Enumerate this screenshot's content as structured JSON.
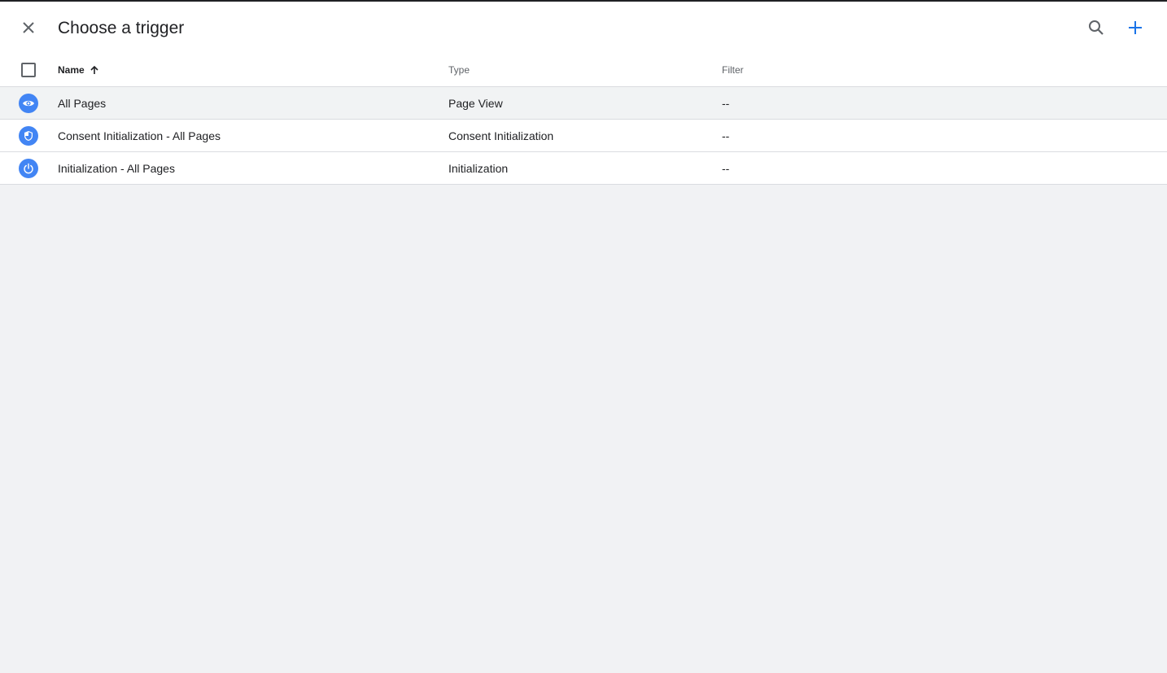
{
  "header": {
    "title": "Choose a trigger",
    "close_icon": "close-icon",
    "search_icon": "search-icon",
    "add_icon": "add-icon",
    "accent_color": "#1a73e8"
  },
  "table": {
    "columns": {
      "name": "Name",
      "type": "Type",
      "filter": "Filter"
    },
    "sort": "ascending",
    "rows": [
      {
        "icon": "eye-icon",
        "name": "All Pages",
        "type": "Page View",
        "filter": "--"
      },
      {
        "icon": "shield-icon",
        "name": "Consent Initialization - All Pages",
        "type": "Consent Initialization",
        "filter": "--"
      },
      {
        "icon": "power-icon",
        "name": "Initialization - All Pages",
        "type": "Initialization",
        "filter": "--"
      }
    ]
  }
}
